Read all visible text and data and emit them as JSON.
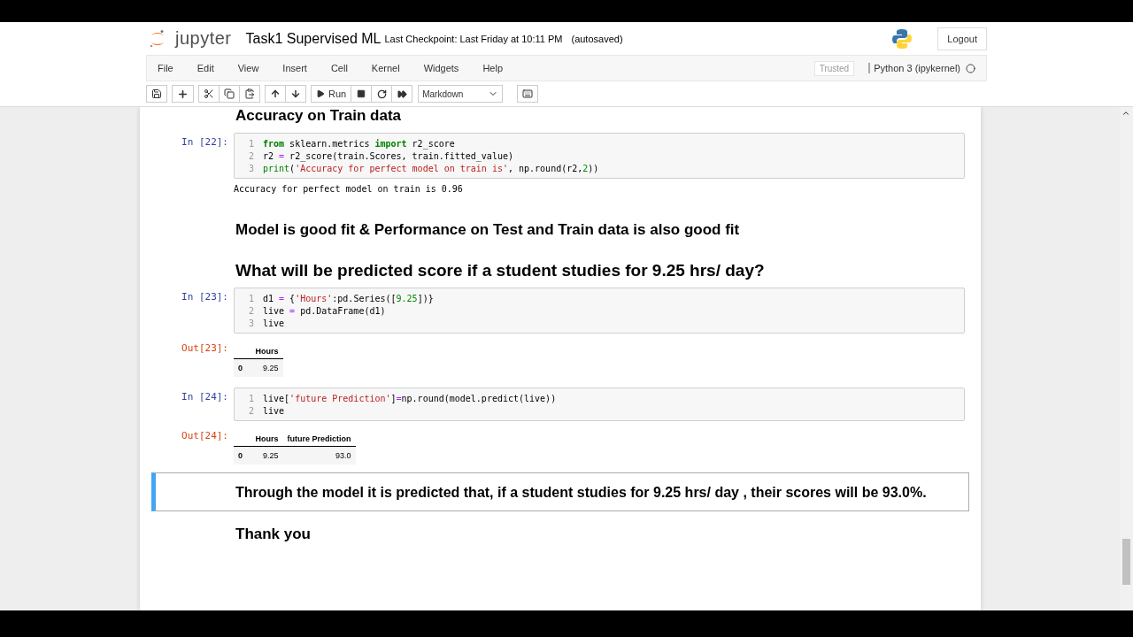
{
  "header": {
    "logo_text": "jupyter",
    "title": "Task1 Supervised ML",
    "checkpoint": "Last Checkpoint: Last Friday at 10:11 PM",
    "autosave": "(autosaved)",
    "logout": "Logout"
  },
  "menu": [
    "File",
    "Edit",
    "View",
    "Insert",
    "Cell",
    "Kernel",
    "Widgets",
    "Help"
  ],
  "status": {
    "trusted": "Trusted",
    "kernel": "Python 3 (ipykernel)"
  },
  "toolbar": {
    "run_label": "Run",
    "cell_type": "Markdown"
  },
  "cells": [
    {
      "kind": "heading",
      "text": "Accuracy on Train data"
    },
    {
      "kind": "code",
      "selected": false,
      "prompt": "In [22]:",
      "lines": [
        {
          "number": "1",
          "tokens": [
            {
              "kind": "kw",
              "t": "from"
            },
            {
              "kind": "plain",
              "t": " sklearn.metrics "
            },
            {
              "kind": "kw",
              "t": "import"
            },
            {
              "kind": "plain",
              "t": " r2_score"
            }
          ]
        },
        {
          "number": "2",
          "tokens": [
            {
              "kind": "plain",
              "t": "r2 "
            },
            {
              "kind": "op",
              "t": "="
            },
            {
              "kind": "plain",
              "t": " r2_score(train.Scores, train.fitted_value)"
            }
          ]
        },
        {
          "number": "3",
          "tokens": [
            {
              "kind": "builtin",
              "t": "print"
            },
            {
              "kind": "plain",
              "t": "("
            },
            {
              "kind": "str",
              "t": "'Accuracy for perfect model on train is'"
            },
            {
              "kind": "plain",
              "t": ", np.round(r2,"
            },
            {
              "kind": "num",
              "t": "2"
            },
            {
              "kind": "plain",
              "t": "))"
            }
          ]
        }
      ],
      "stream": "Accuracy for perfect model on train is 0.96"
    },
    {
      "kind": "heading",
      "text": "Model is good fit & Performance on Test and Train data is also good fit"
    },
    {
      "kind": "heading",
      "text": "What will be predicted score if a student studies for 9.25 hrs/ day?"
    },
    {
      "kind": "code",
      "selected": false,
      "prompt": "In [23]:",
      "lines": [
        {
          "number": "1",
          "tokens": [
            {
              "kind": "plain",
              "t": "d1 "
            },
            {
              "kind": "op",
              "t": "="
            },
            {
              "kind": "plain",
              "t": " {"
            },
            {
              "kind": "str",
              "t": "'Hours'"
            },
            {
              "kind": "plain",
              "t": ":pd.Series(["
            },
            {
              "kind": "num",
              "t": "9.25"
            },
            {
              "kind": "plain",
              "t": "])}"
            }
          ]
        },
        {
          "number": "2",
          "tokens": [
            {
              "kind": "plain",
              "t": "live "
            },
            {
              "kind": "op",
              "t": "="
            },
            {
              "kind": "plain",
              "t": " pd.DataFrame(d1)"
            }
          ]
        },
        {
          "number": "3",
          "tokens": [
            {
              "kind": "plain",
              "t": "live"
            }
          ]
        }
      ],
      "out_prompt": "Out[23]:",
      "table": {
        "columns": [
          "Hours"
        ],
        "rows": [
          {
            "index": "0",
            "values": [
              "9.25"
            ]
          }
        ]
      }
    },
    {
      "kind": "code",
      "selected": false,
      "prompt": "In [24]:",
      "lines": [
        {
          "number": "1",
          "tokens": [
            {
              "kind": "plain",
              "t": "live["
            },
            {
              "kind": "str",
              "t": "'future Prediction'"
            },
            {
              "kind": "plain",
              "t": "]"
            },
            {
              "kind": "op",
              "t": "="
            },
            {
              "kind": "plain",
              "t": "np.round(model.predict(live))"
            }
          ]
        },
        {
          "number": "2",
          "tokens": [
            {
              "kind": "plain",
              "t": "live"
            }
          ]
        }
      ],
      "out_prompt": "Out[24]:",
      "table": {
        "columns": [
          "Hours",
          "future Prediction"
        ],
        "rows": [
          {
            "index": "0",
            "values": [
              "9.25",
              "93.0"
            ]
          }
        ]
      }
    },
    {
      "kind": "markdown",
      "selected": true,
      "text": "Through the model it is predicted that, if a student studies for 9.25 hrs/ day , their scores will be 93.0%."
    },
    {
      "kind": "heading",
      "text": "Thank you"
    }
  ]
}
